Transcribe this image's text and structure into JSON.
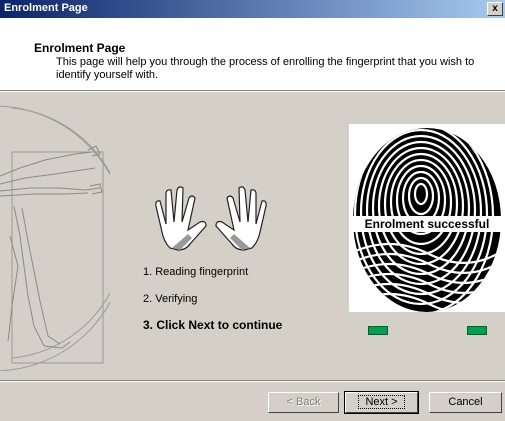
{
  "window": {
    "title": "Enrolment Page",
    "close_glyph": "x"
  },
  "header": {
    "title": "Enrolment Page",
    "description": "This page will help you through the process of enrolling the fingerprint that you wish to identify yourself with."
  },
  "steps": [
    {
      "label": "1. Reading fingerprint",
      "state": "done"
    },
    {
      "label": "2. Verifying",
      "state": "done"
    },
    {
      "label": "3. Click Next to continue",
      "state": "active"
    }
  ],
  "fingerprint": {
    "status": "Enrolment successful",
    "indicators": [
      "green",
      "green"
    ]
  },
  "buttons": {
    "back": "< Back",
    "next": "Next >",
    "cancel": "Cancel"
  },
  "colors": {
    "indicator": "#00a050",
    "title_gradient_start": "#0a246a",
    "title_gradient_end": "#a6caf0"
  }
}
